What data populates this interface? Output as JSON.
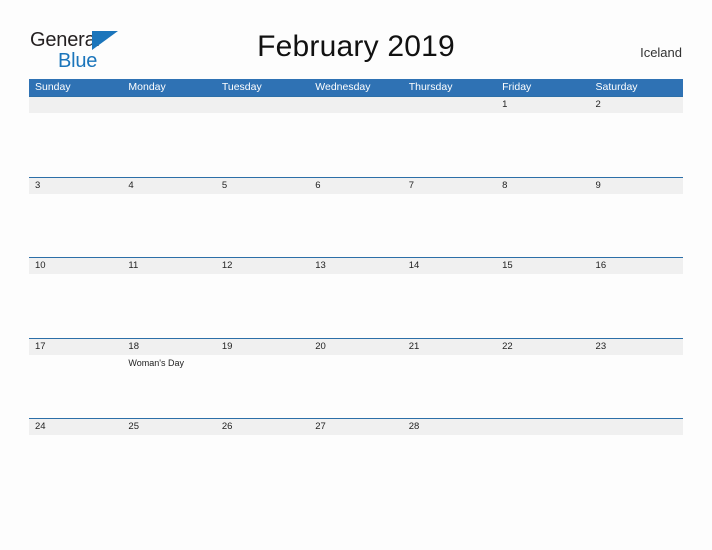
{
  "header": {
    "logo": {
      "word_dark": "General",
      "word_blue": "Blue",
      "flag_icon": "blue-triangle-flag-icon"
    },
    "title": "February 2019",
    "country": "Iceland"
  },
  "colors": {
    "header_blue": "#2f72b4",
    "row_rule_blue": "#2c6fa8",
    "daynum_band_gray": "#f0f0f0",
    "logo_blue": "#1b75bb",
    "page_background": "#fdfdfd",
    "text_dark": "#222222"
  },
  "calendar": {
    "weekdays": [
      "Sunday",
      "Monday",
      "Tuesday",
      "Wednesday",
      "Thursday",
      "Friday",
      "Saturday"
    ],
    "weeks": [
      {
        "days": [
          {
            "num": "",
            "event": ""
          },
          {
            "num": "",
            "event": ""
          },
          {
            "num": "",
            "event": ""
          },
          {
            "num": "",
            "event": ""
          },
          {
            "num": "",
            "event": ""
          },
          {
            "num": "1",
            "event": ""
          },
          {
            "num": "2",
            "event": ""
          }
        ]
      },
      {
        "days": [
          {
            "num": "3",
            "event": ""
          },
          {
            "num": "4",
            "event": ""
          },
          {
            "num": "5",
            "event": ""
          },
          {
            "num": "6",
            "event": ""
          },
          {
            "num": "7",
            "event": ""
          },
          {
            "num": "8",
            "event": ""
          },
          {
            "num": "9",
            "event": ""
          }
        ]
      },
      {
        "days": [
          {
            "num": "10",
            "event": ""
          },
          {
            "num": "11",
            "event": ""
          },
          {
            "num": "12",
            "event": ""
          },
          {
            "num": "13",
            "event": ""
          },
          {
            "num": "14",
            "event": ""
          },
          {
            "num": "15",
            "event": ""
          },
          {
            "num": "16",
            "event": ""
          }
        ]
      },
      {
        "days": [
          {
            "num": "17",
            "event": ""
          },
          {
            "num": "18",
            "event": "Woman's Day"
          },
          {
            "num": "19",
            "event": ""
          },
          {
            "num": "20",
            "event": ""
          },
          {
            "num": "21",
            "event": ""
          },
          {
            "num": "22",
            "event": ""
          },
          {
            "num": "23",
            "event": ""
          }
        ]
      },
      {
        "days": [
          {
            "num": "24",
            "event": ""
          },
          {
            "num": "25",
            "event": ""
          },
          {
            "num": "26",
            "event": ""
          },
          {
            "num": "27",
            "event": ""
          },
          {
            "num": "28",
            "event": ""
          },
          {
            "num": "",
            "event": ""
          },
          {
            "num": "",
            "event": ""
          }
        ]
      }
    ]
  }
}
